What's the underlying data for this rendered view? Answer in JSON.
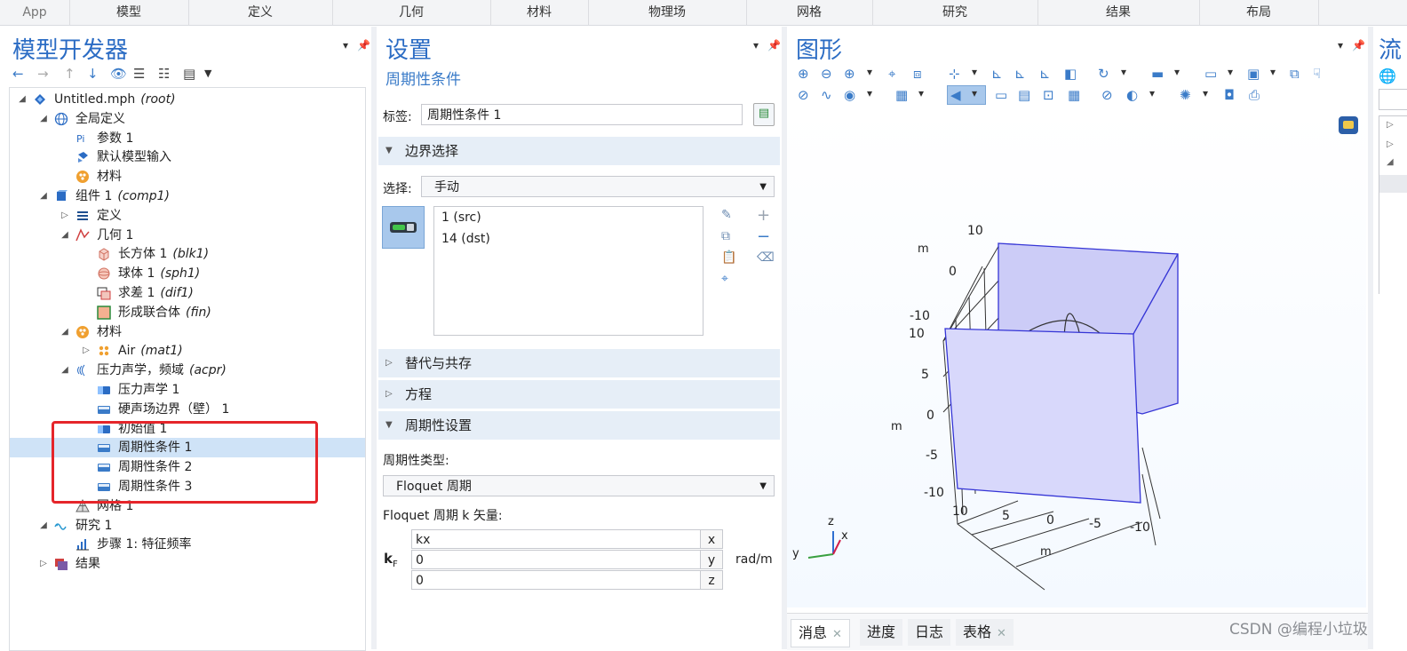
{
  "ribbon": {
    "tabs": [
      "App",
      "模型",
      "定义",
      "几何",
      "材料",
      "物理场",
      "网格",
      "研究",
      "结果",
      "布局"
    ]
  },
  "model_builder": {
    "title": "模型开发器",
    "tree": [
      {
        "label": "Untitled.mph",
        "tag": "(root)",
        "icon": "file-icon"
      },
      {
        "label": "全局定义",
        "tag": "",
        "icon": "globe-icon"
      },
      {
        "label": "参数 1",
        "tag": "",
        "icon": "parameter-icon"
      },
      {
        "label": "默认模型输入",
        "tag": "",
        "icon": "model-input-icon"
      },
      {
        "label": "材料",
        "tag": "",
        "icon": "materials-icon"
      },
      {
        "label": "组件 1",
        "tag": "(comp1)",
        "icon": "component-icon"
      },
      {
        "label": "定义",
        "tag": "",
        "icon": "definitions-icon"
      },
      {
        "label": "几何 1",
        "tag": "",
        "icon": "geometry-icon"
      },
      {
        "label": "长方体 1",
        "tag": "(blk1)",
        "icon": "block-icon"
      },
      {
        "label": "球体 1",
        "tag": "(sph1)",
        "icon": "sphere-icon"
      },
      {
        "label": "求差 1",
        "tag": "(dif1)",
        "icon": "difference-icon"
      },
      {
        "label": "形成联合体",
        "tag": "(fin)",
        "icon": "form-union-icon"
      },
      {
        "label": "材料",
        "tag": "",
        "icon": "materials-icon"
      },
      {
        "label": "Air",
        "tag": "(mat1)",
        "icon": "material-icon"
      },
      {
        "label": "压力声学，频域",
        "tag": "(acpr)",
        "icon": "acoustics-icon"
      },
      {
        "label": "压力声学 1",
        "tag": "",
        "icon": "physics-node-icon"
      },
      {
        "label": "硬声场边界（壁） 1",
        "tag": "",
        "icon": "boundary-node-icon"
      },
      {
        "label": "初始值 1",
        "tag": "",
        "icon": "physics-node-icon"
      },
      {
        "label": "周期性条件 1",
        "tag": "",
        "icon": "boundary-node-icon"
      },
      {
        "label": "周期性条件 2",
        "tag": "",
        "icon": "boundary-node-icon"
      },
      {
        "label": "周期性条件 3",
        "tag": "",
        "icon": "boundary-node-icon"
      },
      {
        "label": "网格 1",
        "tag": "",
        "icon": "mesh-icon"
      },
      {
        "label": "研究 1",
        "tag": "",
        "icon": "study-icon"
      },
      {
        "label": "步骤 1: 特征频率",
        "tag": "",
        "icon": "study-step-icon"
      },
      {
        "label": "结果",
        "tag": "",
        "icon": "results-icon"
      }
    ]
  },
  "settings": {
    "title": "设置",
    "subtitle": "周期性条件",
    "label_caption": "标签:",
    "label_value": "周期性条件 1",
    "sections": {
      "boundary": "边界选择",
      "override": "替代与共存",
      "equation": "方程",
      "periodic": "周期性设置"
    },
    "selection_caption": "选择:",
    "selection_value": "手动",
    "boundaries": [
      "1 (src)",
      "14 (dst)"
    ],
    "periodic_type_caption": "周期性类型:",
    "periodic_type_value": "Floquet 周期",
    "k_caption": "Floquet 周期 k 矢量:",
    "k_symbol": "k",
    "k_sub": "F",
    "k_components": [
      {
        "value": "kx",
        "axis": "x"
      },
      {
        "value": "0",
        "axis": "y"
      },
      {
        "value": "0",
        "axis": "z"
      }
    ],
    "k_unit": "rad/m"
  },
  "graphics": {
    "title": "图形",
    "z_ticks": [
      "10",
      "5",
      "0",
      "-5",
      "-10"
    ],
    "x_ticks": [
      "10",
      "5",
      "0",
      "-5",
      "-10"
    ],
    "top_ticks": [
      "10",
      "0",
      "-10"
    ],
    "unit": "m",
    "triad": {
      "x": "x",
      "y": "y",
      "z": "z"
    }
  },
  "bottom_tabs": [
    "消息",
    "进度",
    "日志",
    "表格"
  ],
  "watermark": "CSDN @编程小垃圾",
  "colors": {
    "accent": "#2b6cc4",
    "selection": "#cfe3f7",
    "highlight_box": "#e5252a",
    "face_fill": "#ccccf7"
  }
}
